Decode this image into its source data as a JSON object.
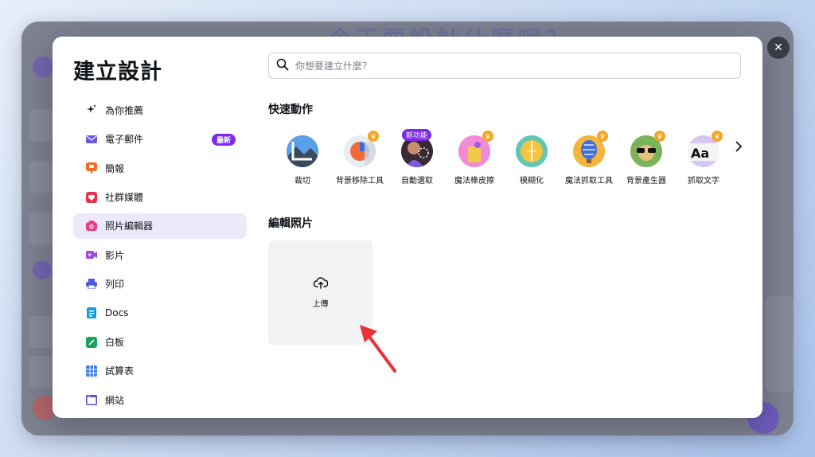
{
  "background_app": {
    "title_ghost": "今天要設計什麼呢？"
  },
  "modal": {
    "title": "建立設計",
    "search": {
      "placeholder": "你想要建立什麼？",
      "value": ""
    },
    "sidebar": {
      "items": [
        {
          "label": "為你推薦",
          "icon": "sparkles-icon"
        },
        {
          "label": "電子郵件",
          "icon": "envelope-icon",
          "badge": "最新"
        },
        {
          "label": "簡報",
          "icon": "presentation-icon"
        },
        {
          "label": "社群媒體",
          "icon": "heart-icon"
        },
        {
          "label": "照片編輯器",
          "icon": "camera-icon",
          "active": true
        },
        {
          "label": "影片",
          "icon": "video-icon"
        },
        {
          "label": "列印",
          "icon": "printer-icon"
        },
        {
          "label": "Docs",
          "icon": "docs-icon"
        },
        {
          "label": "白板",
          "icon": "whiteboard-icon"
        },
        {
          "label": "試算表",
          "icon": "spreadsheet-icon"
        },
        {
          "label": "網站",
          "icon": "website-icon"
        }
      ]
    },
    "quick_actions": {
      "title": "快速動作",
      "items": [
        {
          "label": "裁切"
        },
        {
          "label": "背景移除工具",
          "pro": true
        },
        {
          "label": "自動選取",
          "new_badge": "新功能"
        },
        {
          "label": "魔法橡皮擦",
          "pro": true
        },
        {
          "label": "模糊化"
        },
        {
          "label": "魔法抓取工具",
          "pro": true
        },
        {
          "label": "背景產生器",
          "pro": true
        },
        {
          "label": "抓取文字",
          "pro": true
        }
      ]
    },
    "edit_photos": {
      "title": "編輯照片",
      "upload_label": "上傳"
    }
  },
  "colors": {
    "accent": "#7d2ae8",
    "active_bg": "#ece9fb",
    "crown": "#f5a623",
    "annotation_arrow": "#e8333b"
  }
}
